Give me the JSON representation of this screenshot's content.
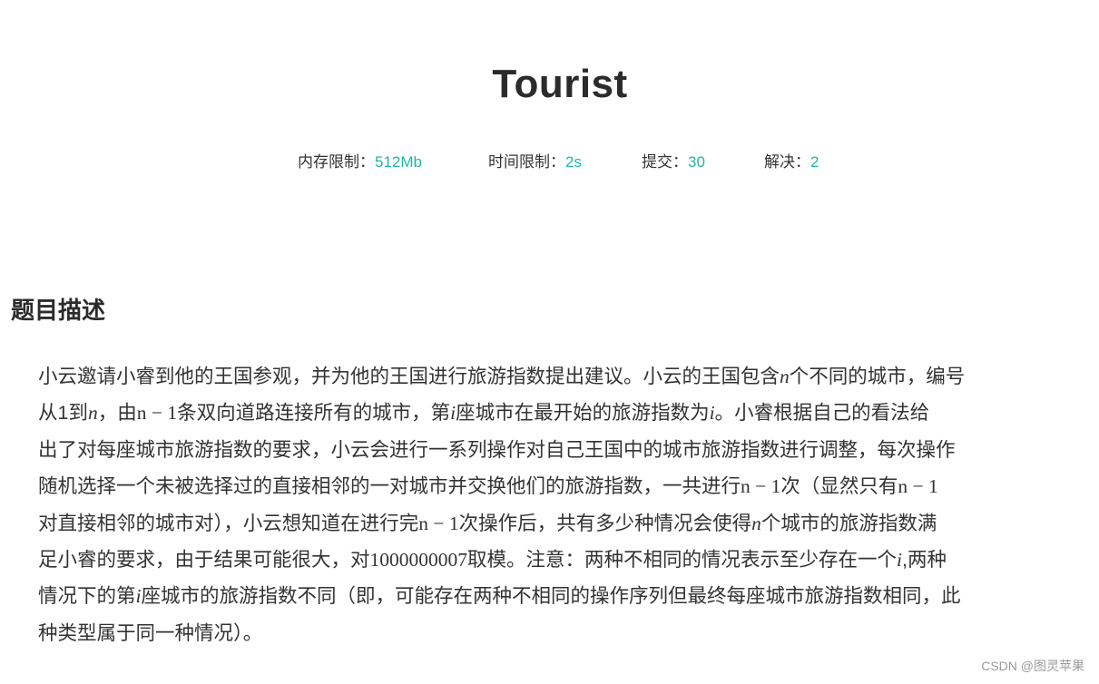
{
  "title": "Tourist",
  "meta": {
    "memory_label": "内存限制：",
    "memory_value": "512Mb",
    "time_label": "时间限制：",
    "time_value": "2s",
    "submit_label": "提交：",
    "submit_value": "30",
    "solved_label": "解决：",
    "solved_value": "2"
  },
  "section": {
    "heading": "题目描述"
  },
  "description": {
    "l1a": "小云邀请小睿到他的王国参观，并为他的王国进行旅游指数提出建议。小云的王国包含",
    "l1m": "n",
    "l1b": "个不同的城市，编号",
    "l2a": "从1到",
    "l2m1": "n",
    "l2b": "，由",
    "l2m2": "n − 1",
    "l2c": "条双向道路连接所有的城市，第",
    "l2m3": "i",
    "l2d": "座城市在最开始的旅游指数为",
    "l2m4": "i",
    "l2e": "。小睿根据自己的看法给",
    "l3": "出了对每座城市旅游指数的要求，小云会进行一系列操作对自己王国中的城市旅游指数进行调整，每次操作",
    "l4a": "随机选择一个未被选择过的直接相邻的一对城市并交换他们的旅游指数，一共进行",
    "l4m1": "n − 1",
    "l4b": "次（显然只有",
    "l4m2": "n − 1",
    "l5a": "对直接相邻的城市对），小云想知道在进行完",
    "l5m1": "n − 1",
    "l5b": "次操作后，共有多少种情况会使得",
    "l5m2": "n",
    "l5c": "个城市的旅游指数满",
    "l6a": "足小睿的要求，由于结果可能很大，对",
    "l6m1": "1000000007",
    "l6b": "取模。注意：两种不相同的情况表示至少存在一个",
    "l6m2": "i",
    "l6c": ",两种",
    "l7a": "情况下的第",
    "l7m1": "i",
    "l7b": "座城市的旅游指数不同（即，可能存在两种不相同的操作序列但最终每座城市旅游指数相同，此",
    "l8": "种类型属于同一种情况）。"
  },
  "watermark": "CSDN @图灵苹果",
  "colors": {
    "accent": "#1fb7a6",
    "text": "#333333",
    "heading": "#2b2b2b",
    "watermark": "#9a9a9a"
  }
}
